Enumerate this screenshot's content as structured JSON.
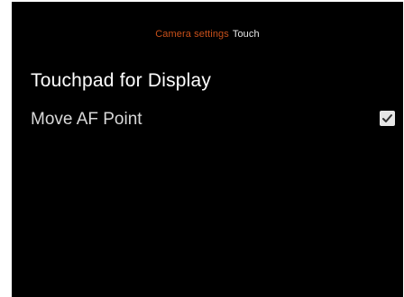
{
  "breadcrumb": {
    "parent": "Camera settings",
    "current": "Touch"
  },
  "section": {
    "title": "Touchpad for Display"
  },
  "settings": [
    {
      "label": "Move AF Point",
      "icon": "checked-checkbox-icon",
      "checked": true
    }
  ],
  "colors": {
    "background": "#000000",
    "accent": "#c8501a",
    "text": "#ffffff"
  }
}
